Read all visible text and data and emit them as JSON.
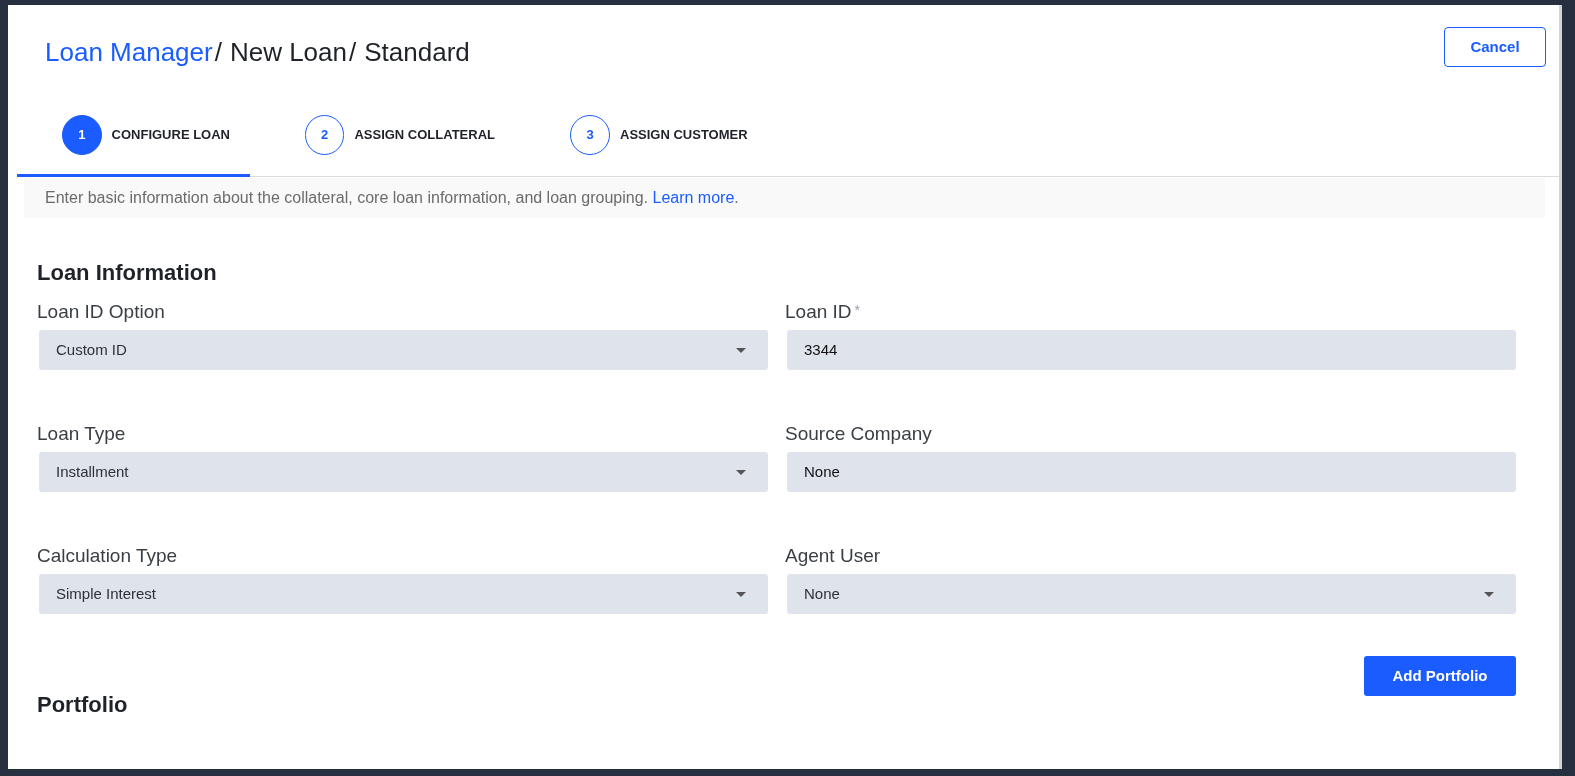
{
  "breadcrumb": [
    {
      "label": "Loan Manager",
      "link": true,
      "separator": "/"
    },
    {
      "label": "New Loan",
      "link": false,
      "separator": "/"
    },
    {
      "label": "Standard",
      "link": false
    }
  ],
  "cancel_button": "Cancel",
  "steps": [
    {
      "number": "1",
      "label": "CONFIGURE LOAN",
      "selected": true
    },
    {
      "number": "2",
      "label": "ASSIGN COLLATERAL",
      "selected": false
    },
    {
      "number": "3",
      "label": "ASSIGN CUSTOMER",
      "selected": false
    }
  ],
  "intro": {
    "text": "Enter basic information about the collateral, core loan information, and loan grouping.",
    "link": "Learn more",
    "after_link": "."
  },
  "section_title": "Loan Information",
  "fields": [
    {
      "label": "Loan ID Option",
      "kind": "select",
      "value": "Custom ID"
    },
    {
      "label": "Loan ID",
      "kind": "text",
      "value": "3344",
      "required_mark": "*"
    },
    {
      "label": "Loan Type",
      "kind": "select",
      "value": "Installment"
    },
    {
      "label": "Source Company",
      "kind": "text",
      "value": "None"
    },
    {
      "label": "Calculation Type",
      "kind": "select",
      "value": "Simple Interest"
    },
    {
      "label": "Agent User",
      "kind": "select",
      "value": "None"
    }
  ],
  "add_portfolio_button": "Add Portfolio",
  "portfolio_title": "Portfolio"
}
